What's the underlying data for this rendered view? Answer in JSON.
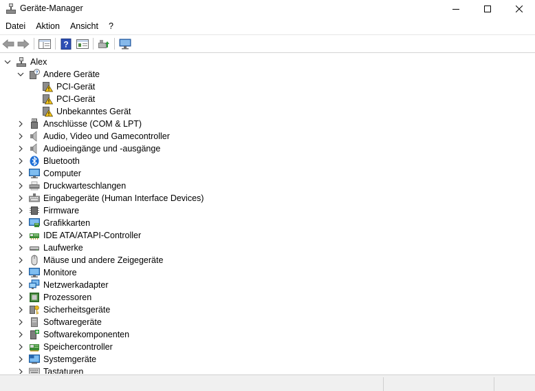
{
  "window": {
    "title": "Geräte-Manager"
  },
  "menu": {
    "items": [
      "Datei",
      "Aktion",
      "Ansicht",
      "?"
    ]
  },
  "tree": {
    "root": "Alex",
    "expanded_group": "Andere Geräte",
    "expanded_children": [
      "PCI-Gerät",
      "PCI-Gerät",
      "Unbekanntes Gerät"
    ],
    "categories": [
      "Anschlüsse (COM & LPT)",
      "Audio, Video und Gamecontroller",
      "Audioeingänge und -ausgänge",
      "Bluetooth",
      "Computer",
      "Druckwarteschlangen",
      "Eingabegeräte (Human Interface Devices)",
      "Firmware",
      "Grafikkarten",
      "IDE ATA/ATAPI-Controller",
      "Laufwerke",
      "Mäuse und andere Zeigegeräte",
      "Monitore",
      "Netzwerkadapter",
      "Prozessoren",
      "Sicherheitsgeräte",
      "Softwaregeräte",
      "Softwarekomponenten",
      "Speichercontroller",
      "Systemgeräte",
      "Tastaturen"
    ]
  }
}
